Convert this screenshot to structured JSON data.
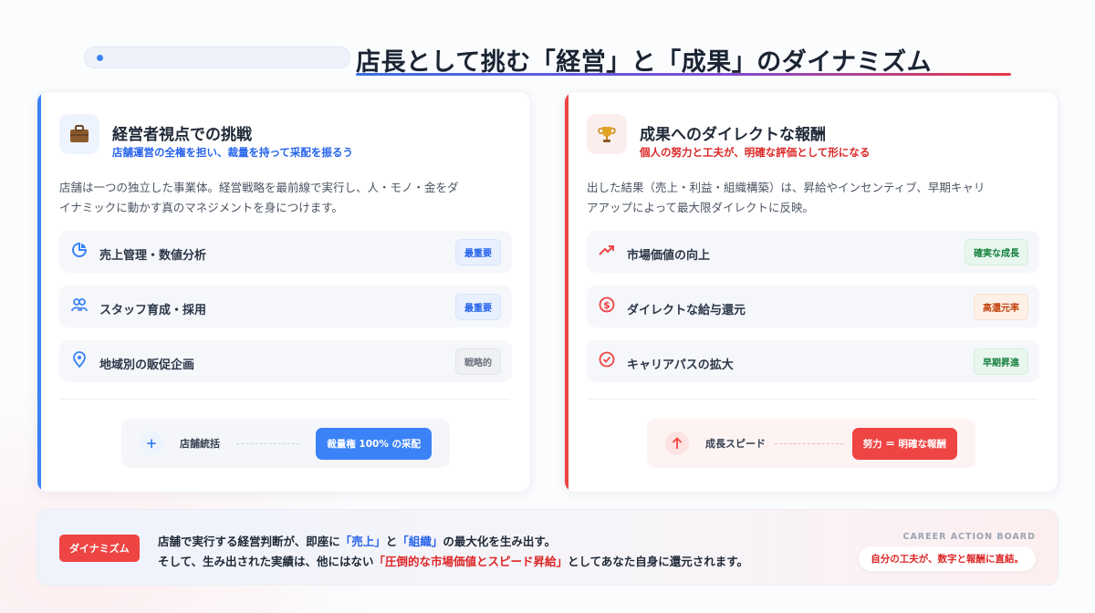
{
  "header": {
    "title": "店長として挑む「経営」と「成果」のダイナミズム"
  },
  "colors": {
    "accent_blue": "#3b82f6",
    "accent_red": "#ef4444"
  },
  "left_card": {
    "icon": "briefcase-icon",
    "title": "経営者視点での挑戦",
    "subtitle": "店舗運営の全権を担い、裁量を持って采配を振るう",
    "description_line1": "店舗は一つの独立した事業体。経営戦略を最前線で実行し、人・モノ・金をダ",
    "description_line2": "イナミックに動かす真のマネジメントを身につけます。",
    "items": [
      {
        "icon": "pie-chart-icon",
        "label": "売上管理・数値分析",
        "badge": "最重要"
      },
      {
        "icon": "users-icon",
        "label": "スタッフ育成・採用",
        "badge": "最重要"
      },
      {
        "icon": "map-pin-icon",
        "label": "地域別の販促企画",
        "badge": "戦略的"
      }
    ],
    "flow": {
      "icon": "plus-icon",
      "label": "店舗統括",
      "result": "裁量権 100% の采配"
    }
  },
  "right_card": {
    "icon": "trophy-icon",
    "title": "成果へのダイレクトな報酬",
    "subtitle": "個人の努力と工夫が、明確な評価として形になる",
    "description_line1": "出した結果（売上・利益・組織構築）は、昇給やインセンティブ、早期キャリ",
    "description_line2": "アアップによって最大限ダイレクトに反映。",
    "items": [
      {
        "icon": "trending-up-icon",
        "label": "市場価値の向上",
        "badge": "確実な成長"
      },
      {
        "icon": "dollar-icon",
        "label": "ダイレクトな給与還元",
        "badge": "高還元率"
      },
      {
        "icon": "check-circle-icon",
        "label": "キャリアパスの拡大",
        "badge": "早期昇進"
      }
    ],
    "flow": {
      "icon": "arrow-up-icon",
      "label": "成長スピード",
      "result": "努力 ＝ 明確な報酬"
    }
  },
  "bottom": {
    "tag": "ダイナミズム",
    "line1_a": "店舗で実行する経営判断が、即座に",
    "line1_hl1": "「売上」",
    "line1_b": "と",
    "line1_hl2": "「組織」",
    "line1_c": "の最大化を生み出す。",
    "line2_a": "そして、生み出された実績は、他にはない",
    "line2_hl": "「圧倒的な市場価値とスピード昇給」",
    "line2_b": "としてあなた自身に還元されます。",
    "board_label": "CAREER ACTION BOARD",
    "board_note": "自分の工夫が、数字と報酬に直結。"
  }
}
